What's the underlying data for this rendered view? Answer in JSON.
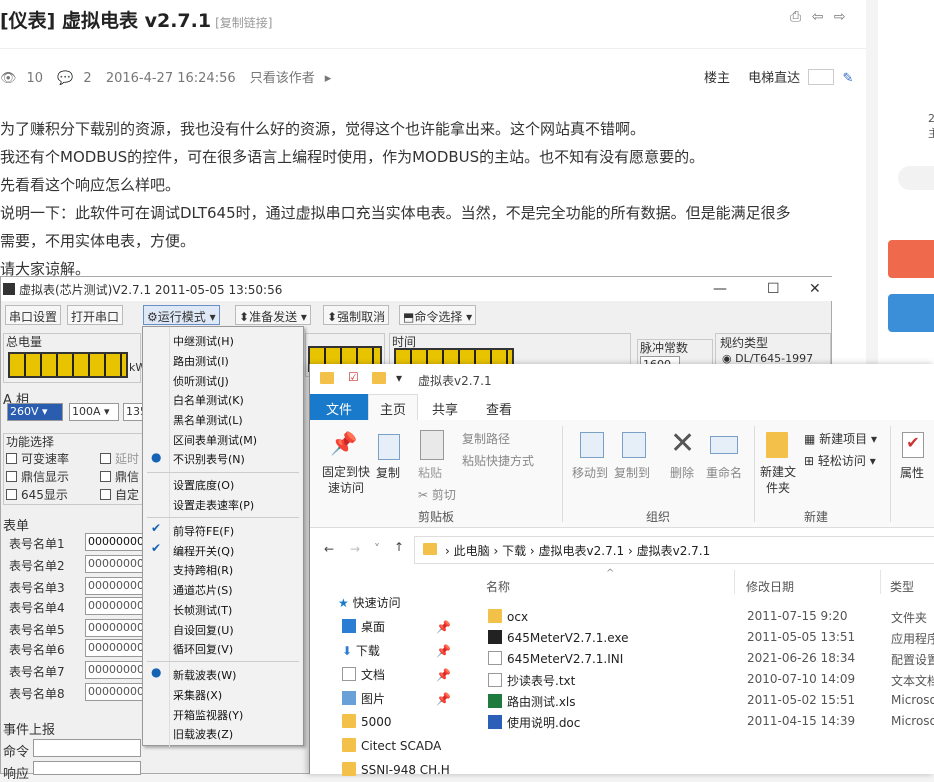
{
  "post": {
    "title": "[仪表] 虚拟电表 v2.7.1",
    "copy_link": "[复制链接]",
    "views": "10",
    "replies": "2",
    "datetime": "2016-4-27 16:24:56",
    "only_author": "只看该作者",
    "floor": "楼主",
    "elevator": "电梯直达",
    "paragraphs": [
      "为了赚积分下载别的资源，我也没有什么好的资源，觉得这个也许能拿出来。这个网站真不错啊。",
      "我还有个MODBUS的控件，可在很多语言上编程时使用，作为MODBUS的主站。也不知有没有愿意要的。",
      "先看看这个响应怎么样吧。",
      "说明一下：此软件可在调试DLT645时，通过虚拟串口充当实体电表。当然，不是完全功能的所有数据。但是能满足很多",
      "需要，不用实体电表，方便。",
      "请大家谅解。"
    ]
  },
  "meter": {
    "title": "虚拟表(芯片测试)V2.7.1 2011-05-05 13:50:56",
    "toolbar": [
      "串口设置",
      "打开串口",
      "运行模式",
      "准备发送",
      "强制取消",
      "命令选择"
    ],
    "total_energy": "总电量",
    "phase_a": "A 相",
    "voltage": "260V",
    "current": "100A",
    "v135": "135",
    "unit": "kW",
    "time": "时间",
    "pulse": "脉冲常数",
    "pulse_val": "1600",
    "protocol": "规约类型",
    "protocol_val": "DL/T645-1997",
    "func": "功能选择",
    "checks": [
      "可变速率",
      "鼎信显示",
      "645显示",
      "延时",
      "鼎信",
      "自定"
    ],
    "meter_table": "表单",
    "rows": [
      "表号名单1",
      "表号名单2",
      "表号名单3",
      "表号名单4",
      "表号名单5",
      "表号名单6",
      "表号名单7",
      "表号名单8"
    ],
    "row1_val": "000000001",
    "row_val": "00000000",
    "event": "事件上报",
    "cmd": "命令",
    "resp": "响应"
  },
  "menu": {
    "items": [
      {
        "label": "中继测试(H)"
      },
      {
        "label": "路由测试(I)"
      },
      {
        "label": "侦听测试(J)"
      },
      {
        "label": "白名单测试(K)"
      },
      {
        "label": "黑名单测试(L)"
      },
      {
        "label": "区间表单测试(M)"
      },
      {
        "label": "不识别表号(N)",
        "mark": "●"
      },
      {
        "label": "设置底度(O)"
      },
      {
        "label": "设置走表速率(P)"
      },
      {
        "label": "前导符FE(F)",
        "mark": "✔"
      },
      {
        "label": "编程开关(Q)",
        "mark": "✔"
      },
      {
        "label": "支持跨相(R)"
      },
      {
        "label": "通道芯片(S)"
      },
      {
        "label": "长帧测试(T)"
      },
      {
        "label": "自设回复(U)"
      },
      {
        "label": "循环回复(V)"
      },
      {
        "label": "新载波表(W)",
        "mark": "●"
      },
      {
        "label": "采集器(X)"
      },
      {
        "label": "开箱监视器(Y)"
      },
      {
        "label": "旧载波表(Z)"
      }
    ]
  },
  "explorer": {
    "title": "虚拟表v2.7.1",
    "tabs": [
      "文件",
      "主页",
      "共享",
      "查看"
    ],
    "ribbon": {
      "pin": "固定到快速访问",
      "copy": "复制",
      "paste": "粘贴",
      "copy_path": "复制路径",
      "paste_shortcut": "粘贴快捷方式",
      "cut": "剪切",
      "move_to": "移动到",
      "copy_to": "复制到",
      "delete": "删除",
      "rename": "重命名",
      "new_folder": "新建文件夹",
      "new_item": "新建项目",
      "easy_access": "轻松访问",
      "properties": "属性",
      "grp_clipboard": "剪贴板",
      "grp_organize": "组织",
      "grp_new": "新建"
    },
    "path": [
      "此电脑",
      "下载",
      "虚拟电表v2.7.1",
      "虚拟表v2.7.1"
    ],
    "columns": [
      "名称",
      "修改日期",
      "类型"
    ],
    "nav": [
      "快速访问",
      "桌面",
      "下载",
      "文档",
      "图片",
      "5000",
      "Citect SCADA",
      "SSNI-948 CH.H"
    ],
    "files": [
      {
        "name": "ocx",
        "date": "2011-07-15 9:20",
        "type": "文件夹"
      },
      {
        "name": "645MeterV2.7.1.exe",
        "date": "2011-05-05 13:51",
        "type": "应用程序"
      },
      {
        "name": "645MeterV2.7.1.INI",
        "date": "2021-06-26 18:34",
        "type": "配置设置"
      },
      {
        "name": "抄读表号.txt",
        "date": "2010-07-10 14:09",
        "type": "文本文档"
      },
      {
        "name": "路由测试.xls",
        "date": "2011-05-02 15:51",
        "type": "Microso"
      },
      {
        "name": "使用说明.doc",
        "date": "2011-04-15 14:39",
        "type": "Microso"
      }
    ]
  },
  "sidebar": {
    "num": "2",
    "label": "主"
  },
  "colors": {
    "orange": "#ef6a4d",
    "blue": "#3b8fd9",
    "ribbon_tab": "#1979ca"
  }
}
